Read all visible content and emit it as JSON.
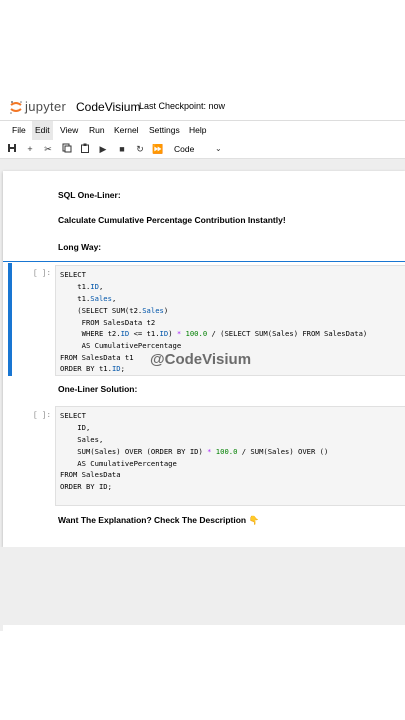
{
  "header": {
    "logo_text": "jupyter",
    "notebook_title": "CodeVisium",
    "checkpoint": "Last Checkpoint: now"
  },
  "menu": [
    "File",
    "Edit",
    "View",
    "Run",
    "Kernel",
    "Settings",
    "Help"
  ],
  "toolbar": {
    "cell_type": "Code",
    "icons": [
      "save-icon",
      "add-icon",
      "cut-icon",
      "copy-icon",
      "paste-icon",
      "run-icon",
      "stop-icon",
      "restart-icon",
      "fast-forward-icon"
    ]
  },
  "cells": {
    "md1": "SQL One-Liner:",
    "md2": "Calculate Cumulative Percentage Contribution Instantly!",
    "md3": "Long Way:",
    "code1_prompt": "[ ]:",
    "code1": [
      "SELECT",
      "    t1.ID,",
      "    t1.Sales,",
      "    (SELECT SUM(t2.Sales)",
      "     FROM SalesData t2",
      "     WHERE t2.ID <= t1.ID) * 100.0 / (SELECT SUM(Sales) FROM SalesData)",
      "     AS CumulativePercentage",
      "FROM SalesData t1",
      "ORDER BY t1.ID;"
    ],
    "md4": "One-Liner Solution:",
    "code2_prompt": "[ ]:",
    "code2": [
      "SELECT",
      "    ID,",
      "    Sales,",
      "    SUM(Sales) OVER (ORDER BY ID) * 100.0 / SUM(Sales) OVER ()",
      "    AS CumulativePercentage",
      "FROM SalesData",
      "ORDER BY ID;"
    ],
    "md5": "Want The Explanation? Check The Description 👇"
  },
  "watermark": "@CodeVisium",
  "colors": {
    "accent": "#1976d2",
    "jupyter_orange": "#f37726"
  }
}
